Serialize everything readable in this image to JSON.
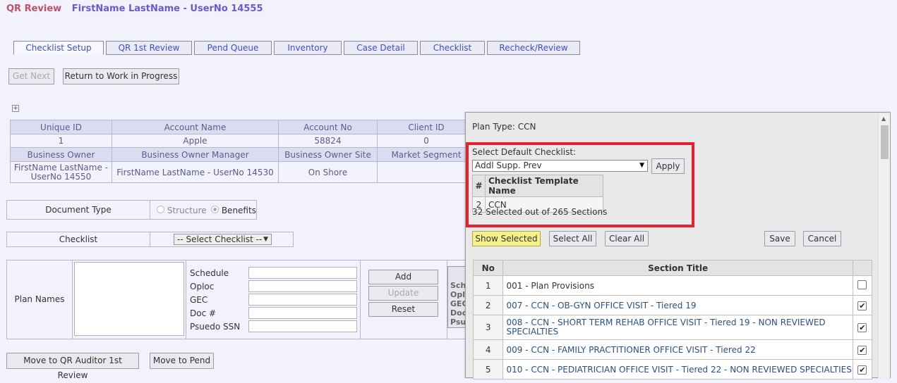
{
  "header": {
    "app_title": "QR Review",
    "user": "FirstName LastName - UserNo 14555"
  },
  "tabs": [
    "Checklist Setup",
    "QR 1st Review",
    "Pend Queue",
    "Inventory",
    "Case Detail",
    "Checklist",
    "Recheck/Review"
  ],
  "actions": {
    "get_next": "Get Next",
    "return_wip": "Return to Work in Progress"
  },
  "expand_icon": "+",
  "info_table": {
    "headers1": [
      "Unique ID",
      "Account Name",
      "Account No",
      "Client ID"
    ],
    "values1": [
      "1",
      "Apple",
      "58824",
      "0"
    ],
    "headers2": [
      "Business Owner",
      "Business Owner Manager",
      "Business Owner Site",
      "Market Segment"
    ],
    "values2": [
      "FirstName LastName - UserNo 14550",
      "FirstName LastName - UserNo 14530",
      "On Shore",
      ""
    ]
  },
  "document_type": {
    "label": "Document Type",
    "options": [
      "Structure",
      "Benefits"
    ],
    "selected": "Benefits"
  },
  "checklist_row": {
    "label": "Checklist",
    "select_value": "-- Select Checklist --"
  },
  "plan": {
    "label": "Plan Names",
    "fields": [
      "Schedule",
      "Oploc",
      "GEC",
      "Doc #",
      "Psuedo SSN"
    ],
    "add": "Add",
    "update": "Update",
    "reset": "Reset",
    "partial_labels": [
      "Sch",
      "Opl",
      "GEC",
      "Doc",
      "Psu"
    ]
  },
  "bottom": {
    "move_qr": "Move to QR Auditor 1st Review",
    "move_pend": "Move to Pend"
  },
  "dialog": {
    "plan_type": "Plan Type: CCN",
    "select_default_label": "Select Default Checklist:",
    "select_value": "Addl Supp. Prev",
    "apply": "Apply",
    "template_headers": [
      "#",
      "Checklist Template Name"
    ],
    "template_row": [
      "2",
      "CCN"
    ],
    "selected_summary": "32 Selected out of 265 Sections",
    "show_selected": "Show Selected",
    "select_all": "Select All",
    "clear_all": "Clear All",
    "save": "Save",
    "cancel": "Cancel",
    "section_headers": [
      "No",
      "Section Title"
    ],
    "sections": [
      {
        "no": "1",
        "title": "001 - Plan Provisions",
        "checked": false
      },
      {
        "no": "2",
        "title": "007 - CCN - OB-GYN OFFICE VISIT - Tiered 19",
        "checked": true
      },
      {
        "no": "3",
        "title": "008 - CCN - SHORT TERM REHAB OFFICE VISIT - Tiered 19 - NON REVIEWED SPECIALTIES",
        "checked": true
      },
      {
        "no": "4",
        "title": "009 - CCN - FAMILY PRACTITIONER OFFICE VISIT - Tiered 22",
        "checked": true
      },
      {
        "no": "5",
        "title": "010 - CCN - PEDIATRICIAN OFFICE VISIT - Tiered 22 - NON REVIEWED SPECIALTIES",
        "checked": true
      }
    ]
  }
}
